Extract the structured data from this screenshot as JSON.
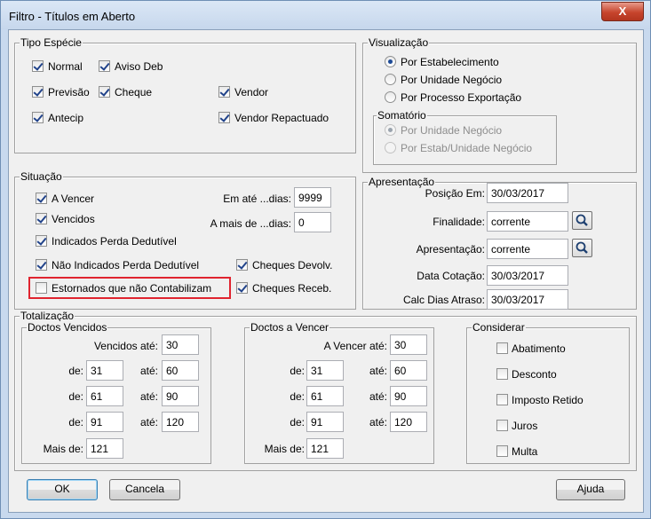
{
  "window": {
    "title": "Filtro - Títulos em Aberto",
    "close_label": "X"
  },
  "tipo_especie": {
    "legend": "Tipo Espécie",
    "items": [
      {
        "label": "Normal",
        "checked": true
      },
      {
        "label": "Aviso Deb",
        "checked": true
      },
      {
        "label": "Previsão",
        "checked": true
      },
      {
        "label": "Cheque",
        "checked": true
      },
      {
        "label": "Vendor",
        "checked": true
      },
      {
        "label": "Antecip",
        "checked": true
      },
      {
        "label": "Vendor Repactuado",
        "checked": true
      }
    ]
  },
  "visualizacao": {
    "legend": "Visualização",
    "options": [
      {
        "label": "Por Estabelecimento",
        "selected": true
      },
      {
        "label": "Por Unidade Negócio",
        "selected": false
      },
      {
        "label": "Por Processo Exportação",
        "selected": false
      }
    ],
    "somatorio": {
      "legend": "Somatório",
      "options": [
        {
          "label": "Por Unidade Negócio",
          "selected": true
        },
        {
          "label": "Por Estab/Unidade Negócio",
          "selected": false
        }
      ]
    }
  },
  "situacao": {
    "legend": "Situação",
    "items": [
      {
        "label": "A Vencer",
        "checked": true
      },
      {
        "label": "Vencidos",
        "checked": true
      },
      {
        "label": "Indicados Perda Dedutível",
        "checked": true
      },
      {
        "label": "Não Indicados Perda Dedutível",
        "checked": true
      },
      {
        "label": "Estornados que não Contabilizam",
        "checked": false
      },
      {
        "label": "Cheques Devolv.",
        "checked": true
      },
      {
        "label": "Cheques Receb.",
        "checked": true
      }
    ],
    "em_ate_label": "Em até ...dias:",
    "em_ate_value": "9999",
    "a_mais_label": "A mais de ...dias:",
    "a_mais_value": "0"
  },
  "apresentacao": {
    "legend": "Apresentação",
    "posicao_label": "Posição Em:",
    "posicao_value": "30/03/2017",
    "finalidade_label": "Finalidade:",
    "finalidade_value": "corrente",
    "apresentacao_label": "Apresentação:",
    "apresentacao_value": "corrente",
    "data_cotacao_label": "Data Cotação:",
    "data_cotacao_value": "30/03/2017",
    "calc_dias_label": "Calc Dias Atraso:",
    "calc_dias_value": "30/03/2017"
  },
  "totalizacao": {
    "legend": "Totalização",
    "vencidos": {
      "legend": "Doctos Vencidos",
      "ate_label": "Vencidos até:",
      "ate_value": "30",
      "rows": [
        {
          "de_label": "de:",
          "de": "31",
          "ate_label": "até:",
          "ate": "60"
        },
        {
          "de_label": "de:",
          "de": "61",
          "ate_label": "até:",
          "ate": "90"
        },
        {
          "de_label": "de:",
          "de": "91",
          "ate_label": "até:",
          "ate": "120"
        }
      ],
      "mais_label": "Mais de:",
      "mais_value": "121"
    },
    "a_vencer": {
      "legend": "Doctos a Vencer",
      "ate_label": "A Vencer até:",
      "ate_value": "30",
      "rows": [
        {
          "de_label": "de:",
          "de": "31",
          "ate_label": "até:",
          "ate": "60"
        },
        {
          "de_label": "de:",
          "de": "61",
          "ate_label": "até:",
          "ate": "90"
        },
        {
          "de_label": "de:",
          "de": "91",
          "ate_label": "até:",
          "ate": "120"
        }
      ],
      "mais_label": "Mais de:",
      "mais_value": "121"
    },
    "considerar": {
      "legend": "Considerar",
      "items": [
        {
          "label": "Abatimento",
          "checked": false
        },
        {
          "label": "Desconto",
          "checked": false
        },
        {
          "label": "Imposto Retido",
          "checked": false
        },
        {
          "label": "Juros",
          "checked": false
        },
        {
          "label": "Multa",
          "checked": false
        }
      ]
    }
  },
  "buttons": {
    "ok": "OK",
    "cancela": "Cancela",
    "ajuda": "Ajuda"
  },
  "colors": {
    "highlight": "#e0242f",
    "close_button": "#c7452d",
    "title_bar": "#c6d7ec"
  },
  "icons": {
    "search": "magnifier-icon",
    "close": "close-icon"
  }
}
